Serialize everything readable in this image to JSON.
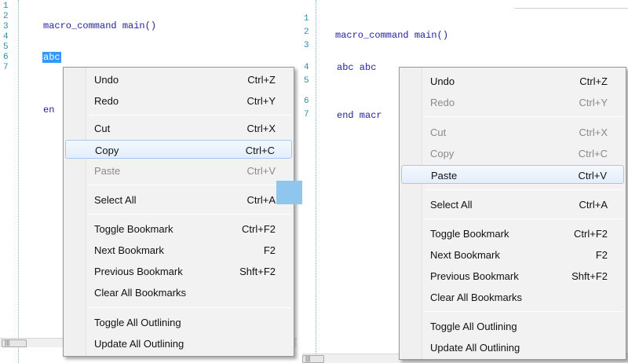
{
  "left": {
    "line_numbers": [
      "1",
      "2",
      "3",
      "4",
      "5",
      "6",
      "7"
    ],
    "code_line2": "macro_command main()",
    "code_line4_selected": "abc",
    "code_line7_partial": "en",
    "scroll_thumb_text": "|||"
  },
  "right": {
    "line_numbers": [
      "1",
      "2",
      "3",
      "4",
      "5",
      "6",
      "7"
    ],
    "code_line2": "macro_command main()",
    "code_line4": "abc abc",
    "code_line7_partial": "end macr",
    "scroll_thumb_text": "|||"
  },
  "menu_left": {
    "items": [
      {
        "label": "Undo",
        "shortcut": "Ctrl+Z",
        "disabled": false,
        "highlighted": false
      },
      {
        "label": "Redo",
        "shortcut": "Ctrl+Y",
        "disabled": false,
        "highlighted": false
      },
      {
        "label": "Cut",
        "shortcut": "Ctrl+X",
        "disabled": false,
        "highlighted": false
      },
      {
        "label": "Copy",
        "shortcut": "Ctrl+C",
        "disabled": false,
        "highlighted": true
      },
      {
        "label": "Paste",
        "shortcut": "Ctrl+V",
        "disabled": true,
        "highlighted": false
      },
      {
        "label": "Select All",
        "shortcut": "Ctrl+A",
        "disabled": false,
        "highlighted": false
      },
      {
        "label": "Toggle Bookmark",
        "shortcut": "Ctrl+F2",
        "disabled": false,
        "highlighted": false
      },
      {
        "label": "Next Bookmark",
        "shortcut": "F2",
        "disabled": false,
        "highlighted": false
      },
      {
        "label": "Previous Bookmark",
        "shortcut": "Shft+F2",
        "disabled": false,
        "highlighted": false
      },
      {
        "label": "Clear All Bookmarks",
        "shortcut": "",
        "disabled": false,
        "highlighted": false
      },
      {
        "label": "Toggle All Outlining",
        "shortcut": "",
        "disabled": false,
        "highlighted": false
      },
      {
        "label": "Update All Outlining",
        "shortcut": "",
        "disabled": false,
        "highlighted": false
      }
    ]
  },
  "menu_right": {
    "items": [
      {
        "label": "Undo",
        "shortcut": "Ctrl+Z",
        "disabled": false,
        "highlighted": false
      },
      {
        "label": "Redo",
        "shortcut": "Ctrl+Y",
        "disabled": true,
        "highlighted": false
      },
      {
        "label": "Cut",
        "shortcut": "Ctrl+X",
        "disabled": true,
        "highlighted": false
      },
      {
        "label": "Copy",
        "shortcut": "Ctrl+C",
        "disabled": true,
        "highlighted": false
      },
      {
        "label": "Paste",
        "shortcut": "Ctrl+V",
        "disabled": false,
        "highlighted": true
      },
      {
        "label": "Select All",
        "shortcut": "Ctrl+A",
        "disabled": false,
        "highlighted": false
      },
      {
        "label": "Toggle Bookmark",
        "shortcut": "Ctrl+F2",
        "disabled": false,
        "highlighted": false
      },
      {
        "label": "Next Bookmark",
        "shortcut": "F2",
        "disabled": false,
        "highlighted": false
      },
      {
        "label": "Previous Bookmark",
        "shortcut": "Shft+F2",
        "disabled": false,
        "highlighted": false
      },
      {
        "label": "Clear All Bookmarks",
        "shortcut": "",
        "disabled": false,
        "highlighted": false
      },
      {
        "label": "Toggle All Outlining",
        "shortcut": "",
        "disabled": false,
        "highlighted": false
      },
      {
        "label": "Update All Outlining",
        "shortcut": "",
        "disabled": false,
        "highlighted": false
      }
    ]
  },
  "colors": {
    "selection": "#3399ff",
    "code_text": "#1f1f9c",
    "line_number": "#2a8fa8",
    "arrow": "#8fc6ee"
  },
  "icons": {
    "transition_arrow": "right-arrow-icon"
  }
}
